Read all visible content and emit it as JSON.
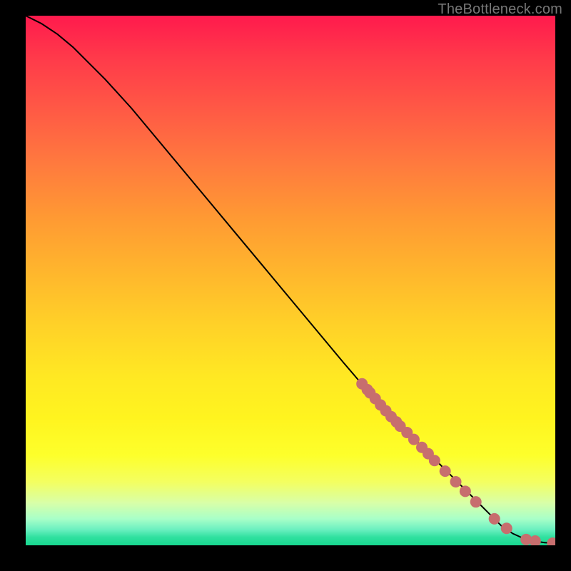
{
  "attribution": "TheBottleneck.com",
  "chart_data": {
    "type": "line",
    "title": "",
    "xlabel": "",
    "ylabel": "",
    "xlim": [
      0,
      100
    ],
    "ylim": [
      0,
      100
    ],
    "grid": false,
    "x": [
      0,
      3,
      6,
      9,
      12,
      15,
      20,
      25,
      30,
      35,
      40,
      45,
      50,
      55,
      60,
      63,
      66,
      68,
      70,
      72,
      74,
      76,
      78,
      80,
      82,
      84,
      85.5,
      87,
      88.5,
      90,
      92,
      94,
      96,
      98,
      100
    ],
    "y": [
      100,
      98.5,
      96.5,
      94,
      91,
      88,
      82.5,
      76.5,
      70.5,
      64.5,
      58.5,
      52.5,
      46.5,
      40.5,
      34.5,
      31,
      27.5,
      25.5,
      23.5,
      21.5,
      19.5,
      17.5,
      15.5,
      13.5,
      11.5,
      9.5,
      8,
      6.5,
      5,
      3.5,
      2.2,
      1.3,
      0.8,
      0.5,
      0.4
    ],
    "markers": {
      "x": [
        63.5,
        64.5,
        65,
        66,
        67,
        68,
        69,
        70,
        70.7,
        72,
        73.3,
        74.8,
        76,
        77.2,
        79.2,
        81.2,
        83,
        85,
        88.5,
        90.8,
        94.5,
        96.2,
        99.5
      ],
      "y": [
        30.5,
        29.4,
        28.8,
        27.7,
        26.5,
        25.4,
        24.3,
        23.3,
        22.5,
        21.3,
        20,
        18.5,
        17.3,
        16,
        14,
        12,
        10.2,
        8.2,
        5,
        3.2,
        1.1,
        0.8,
        0.4
      ],
      "color": "#c76e6e",
      "radius_px": 8
    },
    "background": {
      "type": "vertical-gradient",
      "stops": [
        {
          "pos": 0.0,
          "color": "#ff1a4d"
        },
        {
          "pos": 0.5,
          "color": "#ffbb2b"
        },
        {
          "pos": 0.8,
          "color": "#fff920"
        },
        {
          "pos": 0.95,
          "color": "#9cffc0"
        },
        {
          "pos": 1.0,
          "color": "#18d890"
        }
      ]
    }
  }
}
